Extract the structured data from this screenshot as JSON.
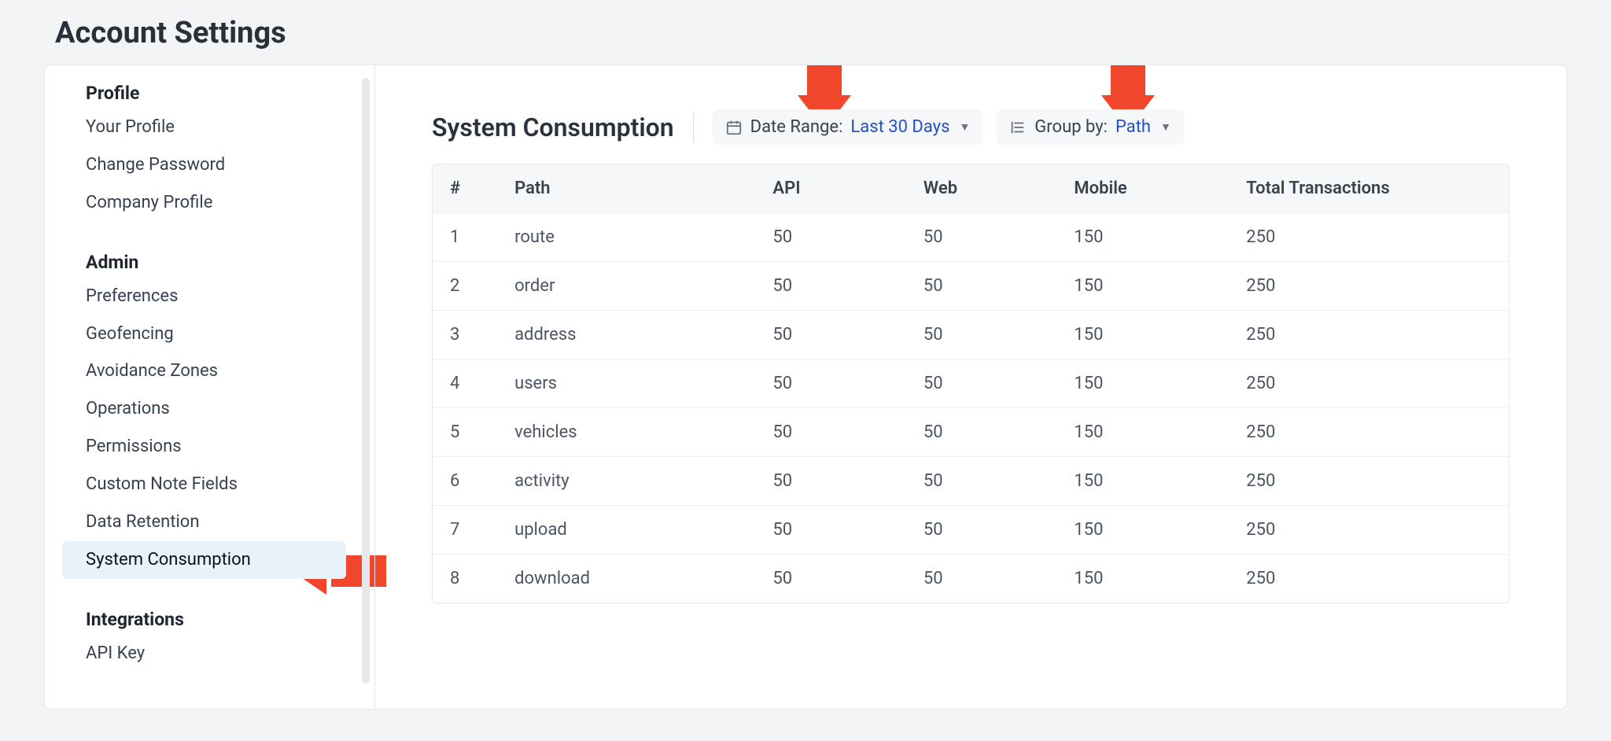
{
  "page": {
    "title": "Account Settings"
  },
  "sidebar": {
    "groups": [
      {
        "heading": "Profile",
        "items": [
          {
            "label": "Your Profile",
            "active": false
          },
          {
            "label": "Change Password",
            "active": false
          },
          {
            "label": "Company Profile",
            "active": false
          }
        ]
      },
      {
        "heading": "Admin",
        "items": [
          {
            "label": "Preferences",
            "active": false
          },
          {
            "label": "Geofencing",
            "active": false
          },
          {
            "label": "Avoidance Zones",
            "active": false
          },
          {
            "label": "Operations",
            "active": false
          },
          {
            "label": "Permissions",
            "active": false
          },
          {
            "label": "Custom Note Fields",
            "active": false
          },
          {
            "label": "Data Retention",
            "active": false
          },
          {
            "label": "System Consumption",
            "active": true
          }
        ]
      },
      {
        "heading": "Integrations",
        "items": [
          {
            "label": "API Key",
            "active": false
          }
        ]
      }
    ]
  },
  "main": {
    "title": "System Consumption",
    "dateRange": {
      "label": "Date Range:",
      "value": "Last 30 Days"
    },
    "groupBy": {
      "label": "Group by:",
      "value": "Path"
    },
    "table": {
      "columns": {
        "idx": "#",
        "path": "Path",
        "api": "API",
        "web": "Web",
        "mobile": "Mobile",
        "total": "Total Transactions"
      },
      "rows": [
        {
          "idx": "1",
          "path": "route",
          "api": "50",
          "web": "50",
          "mobile": "150",
          "total": "250"
        },
        {
          "idx": "2",
          "path": "order",
          "api": "50",
          "web": "50",
          "mobile": "150",
          "total": "250"
        },
        {
          "idx": "3",
          "path": "address",
          "api": "50",
          "web": "50",
          "mobile": "150",
          "total": "250"
        },
        {
          "idx": "4",
          "path": "users",
          "api": "50",
          "web": "50",
          "mobile": "150",
          "total": "250"
        },
        {
          "idx": "5",
          "path": "vehicles",
          "api": "50",
          "web": "50",
          "mobile": "150",
          "total": "250"
        },
        {
          "idx": "6",
          "path": "activity",
          "api": "50",
          "web": "50",
          "mobile": "150",
          "total": "250"
        },
        {
          "idx": "7",
          "path": "upload",
          "api": "50",
          "web": "50",
          "mobile": "150",
          "total": "250"
        },
        {
          "idx": "8",
          "path": "download",
          "api": "50",
          "web": "50",
          "mobile": "150",
          "total": "250"
        }
      ]
    }
  }
}
